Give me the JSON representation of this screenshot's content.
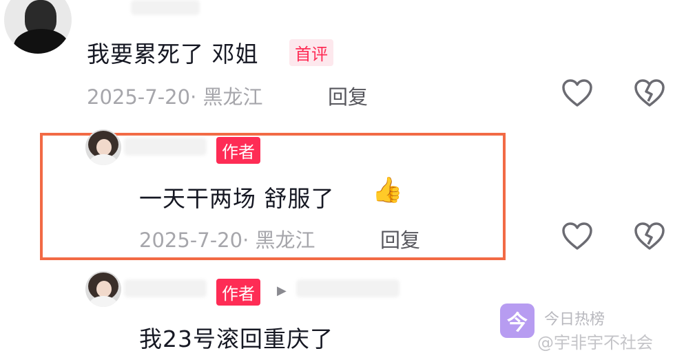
{
  "comments": [
    {
      "text": "我要累死了 邓姐",
      "badge": "首评",
      "date_location": "2025-7-20· 黑龙江",
      "reply_label": "回复"
    },
    {
      "badge": "作者",
      "text": "一天干两场 舒服了",
      "date_location": "2025-7-20· 黑龙江",
      "reply_label": "回复"
    },
    {
      "badge": "作者",
      "text": "我23号滚回重庆了"
    }
  ],
  "icons": {
    "like": "heart-outline-icon",
    "dislike": "broken-heart-icon",
    "emoji": "thumbs-up-emoji",
    "reply_arrow": "play-arrow-icon"
  },
  "watermark": {
    "logo_char": "今",
    "title": "今日热榜",
    "source": "@宇非宇不社会"
  },
  "colors": {
    "highlight_border": "#f26a45",
    "author_badge": "#fe2c55",
    "first_badge_text": "#fe2c55"
  }
}
